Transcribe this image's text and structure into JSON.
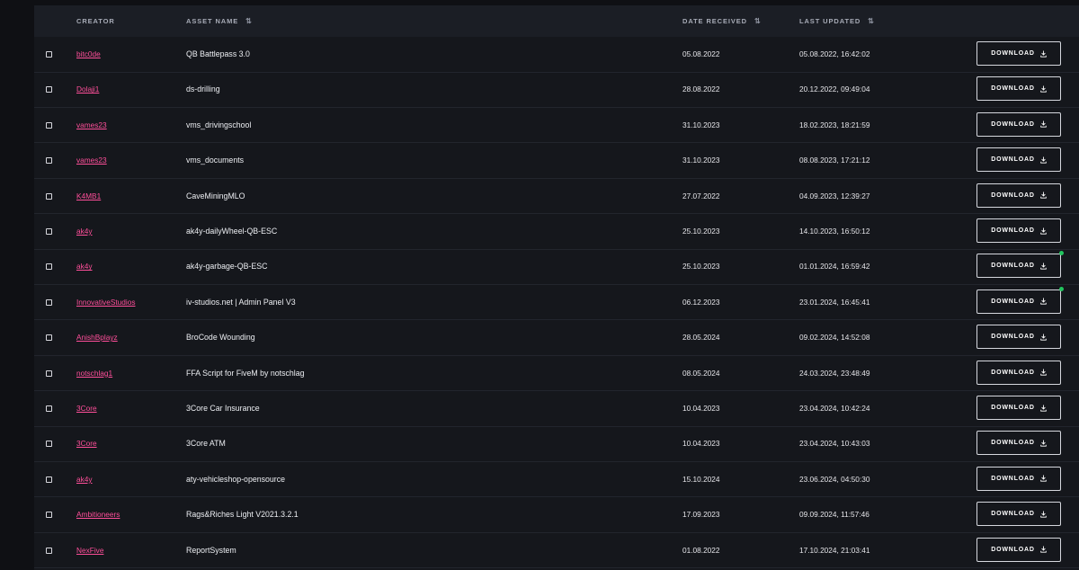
{
  "header": {
    "creator": "CREATOR",
    "asset_name": "ASSET NAME",
    "date_received": "DATE RECEIVED",
    "last_updated": "LAST UPDATED",
    "sort_icon": "⇅"
  },
  "download_label": "DOWNLOAD",
  "colors": {
    "creator_link": "#ff4f9a",
    "status_dot": "#22c55e",
    "background": "#0f1014"
  },
  "rows": [
    {
      "creator": "bitc0de",
      "asset": "QB Battlepass 3.0",
      "date_received": "05.08.2022",
      "last_updated": "05.08.2022, 16:42:02",
      "status_dot": false
    },
    {
      "creator": "Dolaji1",
      "asset": "ds-drilling",
      "date_received": "28.08.2022",
      "last_updated": "20.12.2022, 09:49:04",
      "status_dot": false
    },
    {
      "creator": "vames23",
      "asset": "vms_drivingschool",
      "date_received": "31.10.2023",
      "last_updated": "18.02.2023, 18:21:59",
      "status_dot": false
    },
    {
      "creator": "vames23",
      "asset": "vms_documents",
      "date_received": "31.10.2023",
      "last_updated": "08.08.2023, 17:21:12",
      "status_dot": false
    },
    {
      "creator": "K4MB1",
      "asset": "CaveMiningMLO",
      "date_received": "27.07.2022",
      "last_updated": "04.09.2023, 12:39:27",
      "status_dot": false
    },
    {
      "creator": "ak4y",
      "asset": "ak4y-dailyWheel-QB-ESC",
      "date_received": "25.10.2023",
      "last_updated": "14.10.2023, 16:50:12",
      "status_dot": false
    },
    {
      "creator": "ak4y",
      "asset": "ak4y-garbage-QB-ESC",
      "date_received": "25.10.2023",
      "last_updated": "01.01.2024, 16:59:42",
      "status_dot": true
    },
    {
      "creator": "InnovativeStudios",
      "asset": "iv-studios.net | Admin Panel V3",
      "date_received": "06.12.2023",
      "last_updated": "23.01.2024, 16:45:41",
      "status_dot": true
    },
    {
      "creator": "AnishBplayz",
      "asset": "BroCode Wounding",
      "date_received": "28.05.2024",
      "last_updated": "09.02.2024, 14:52:08",
      "status_dot": false
    },
    {
      "creator": "notschlag1",
      "asset": "FFA Script for FiveM by notschlag",
      "date_received": "08.05.2024",
      "last_updated": "24.03.2024, 23:48:49",
      "status_dot": false
    },
    {
      "creator": "3Core",
      "asset": "3Core Car Insurance",
      "date_received": "10.04.2023",
      "last_updated": "23.04.2024, 10:42:24",
      "status_dot": false
    },
    {
      "creator": "3Core",
      "asset": "3Core ATM",
      "date_received": "10.04.2023",
      "last_updated": "23.04.2024, 10:43:03",
      "status_dot": false
    },
    {
      "creator": "ak4y",
      "asset": "aty-vehicleshop-opensource",
      "date_received": "15.10.2024",
      "last_updated": "23.06.2024, 04:50:30",
      "status_dot": false
    },
    {
      "creator": "Ambitioneers",
      "asset": "Rags&Riches Light V2021.3.2.1",
      "date_received": "17.09.2023",
      "last_updated": "09.09.2024, 11:57:46",
      "status_dot": false
    },
    {
      "creator": "NexFive",
      "asset": "ReportSystem",
      "date_received": "01.08.2022",
      "last_updated": "17.10.2024, 21:03:41",
      "status_dot": false
    }
  ]
}
